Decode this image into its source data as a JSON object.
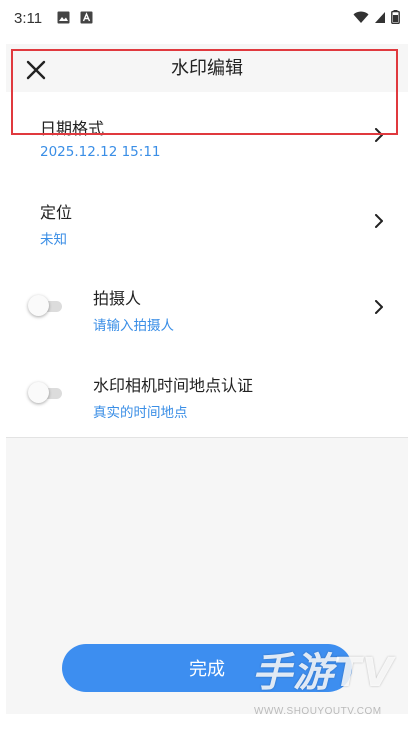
{
  "status_bar": {
    "time": "3:11"
  },
  "header": {
    "title": "水印编辑"
  },
  "rows": [
    {
      "title": "日期格式",
      "subtitle": "2025.12.12 15:11"
    },
    {
      "title": "定位",
      "subtitle": "未知"
    },
    {
      "title": "拍摄人",
      "subtitle": "请输入拍摄人",
      "toggle_on": false
    },
    {
      "title": "水印相机时间地点认证",
      "subtitle": "真实的时间地点",
      "toggle_on": false
    }
  ],
  "done_button": {
    "label": "完成"
  },
  "watermark": {
    "main": "手游TV",
    "sub": "WWW.SHOUYOUTV.COM"
  },
  "colors": {
    "accent": "#3d8ef0",
    "subtitle": "#3a8ee6",
    "highlight": "#e0393e",
    "panel_bg": "#f6f6f6"
  }
}
